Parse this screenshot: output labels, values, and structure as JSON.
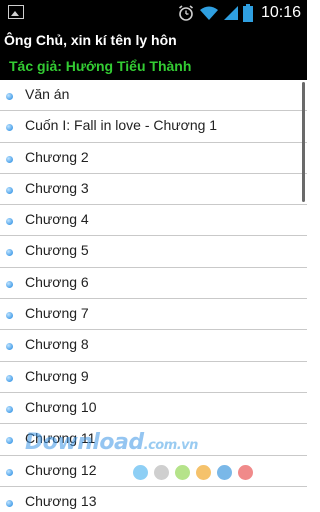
{
  "status_bar": {
    "time": "10:16"
  },
  "header": {
    "title": "Ông Chủ, xin kí tên ly hôn",
    "author": "Tác giả: Hướng Tiểu Thành"
  },
  "list": {
    "items": [
      "Văn án",
      "Cuốn I: Fall in love - Chương 1",
      "Chương 2",
      "Chương 3",
      "Chương 4",
      "Chương 5",
      "Chương 6",
      "Chương 7",
      "Chương 8",
      "Chương 9",
      "Chương 10",
      "Chương 11",
      "Chương 12",
      "Chương 13"
    ]
  },
  "watermark": {
    "main": "Download",
    "suffix": ".com.vn",
    "dot_colors": [
      "#8ecff5",
      "#cfcfcf",
      "#b5e38a",
      "#f5c26b",
      "#7ab8e8",
      "#f08a8a"
    ]
  },
  "colors": {
    "header_bg": "#000000",
    "author_text": "#33cc33",
    "bullet": "#1b86e0"
  }
}
